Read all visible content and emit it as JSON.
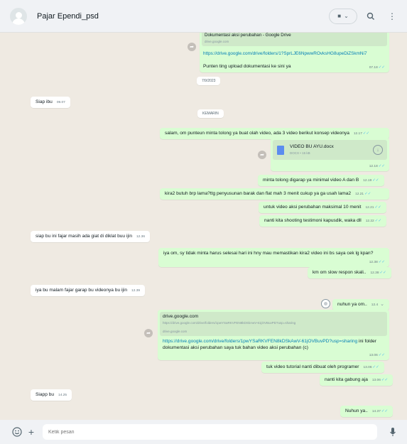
{
  "header": {
    "contact_name": "Pajar Ependi_psd"
  },
  "messages": {
    "m1_title": "Dokumentasi aksi perubahan - Google Drive",
    "m1_domain": "drive.google.com",
    "m1_link": "https://drive.google.com/drive/folders/1?SprLJE6NpwwROvksHG8upeDiZSkmNi7",
    "m1_text": "Punten ting upload dokumentasi ke sini ya",
    "m1_time": "07.18",
    "date1": "7/9/2023",
    "m2_text": "Siap ibu",
    "m2_time": "09.07",
    "date2": "KEMARIN",
    "m3_text": "salam, om punteun minta tolong ya buat olah video, ada 3 video berikut konsep videonya",
    "m3_time": "12.17",
    "doc_name": "VIDEO BU AYU.docx",
    "doc_meta": "DOCX • 15 kB",
    "doc_time": "12.18",
    "m4_text": "minta tolong digarap ya minimal video A dan B",
    "m4_time": "12.19",
    "m5_text": "kira2 butuh brp lama?ttg penyusunan barak dan flat mah 3 menit cukup ya ga usah lama2",
    "m5_time": "12.21",
    "m6_text": "untuk video aksi perubahan maksimal 10 menit",
    "m6_time": "12.21",
    "m7_text": "nanti kita shooting testimoni kapusdik, waka dll",
    "m7_time": "12.22",
    "m8_text": "siap bu ini fajar masih ada giat di diklat buu ijin",
    "m8_time": "12.36",
    "m9_text": "iya om, sy tidak minta harus selesai hari ini hny mau memastikan kira2 video ini bs saya cek lg kpan?",
    "m9_time": "12.38",
    "m10_text": "km om slow respon skali..",
    "m10_time": "12.38",
    "m11_text": "iya bu malam fajar garap bu videonya bu ijin",
    "m11_time": "12.39",
    "m12_text": "nuhun ya om..",
    "m12_time": "12.4",
    "m13_card_title": "drive.google.com",
    "m13_card_url": "https://drive.google.com/drive/folders/1pwYSaRKVFEN8kDSkAwV-61jOVBuvPD?usp=sharing",
    "m13_card_domain": "drive.google.com",
    "m13_link": "https://drive.google.com/drive/folders/1pwYSaRKVFEN8kDSkAwV-61jOVBuvPD?usp=sharing",
    "m13_text": "ini folder dokumentasi aksi perubahan saya tuk bahan video aksi perubahan (c)",
    "m13_time": "13.06",
    "m14_text": "tuk video tutorial nanti dibuat oleh programer",
    "m14_time": "13.06",
    "m15_text": "nanti kita gabung aja",
    "m15_time": "13.06",
    "m16_text": "Siapp bu",
    "m16_time": "14.25",
    "m17_text": "Nuhun ya..",
    "m17_time": "14.37"
  },
  "footer": {
    "input_placeholder": "Ketik pesan"
  }
}
